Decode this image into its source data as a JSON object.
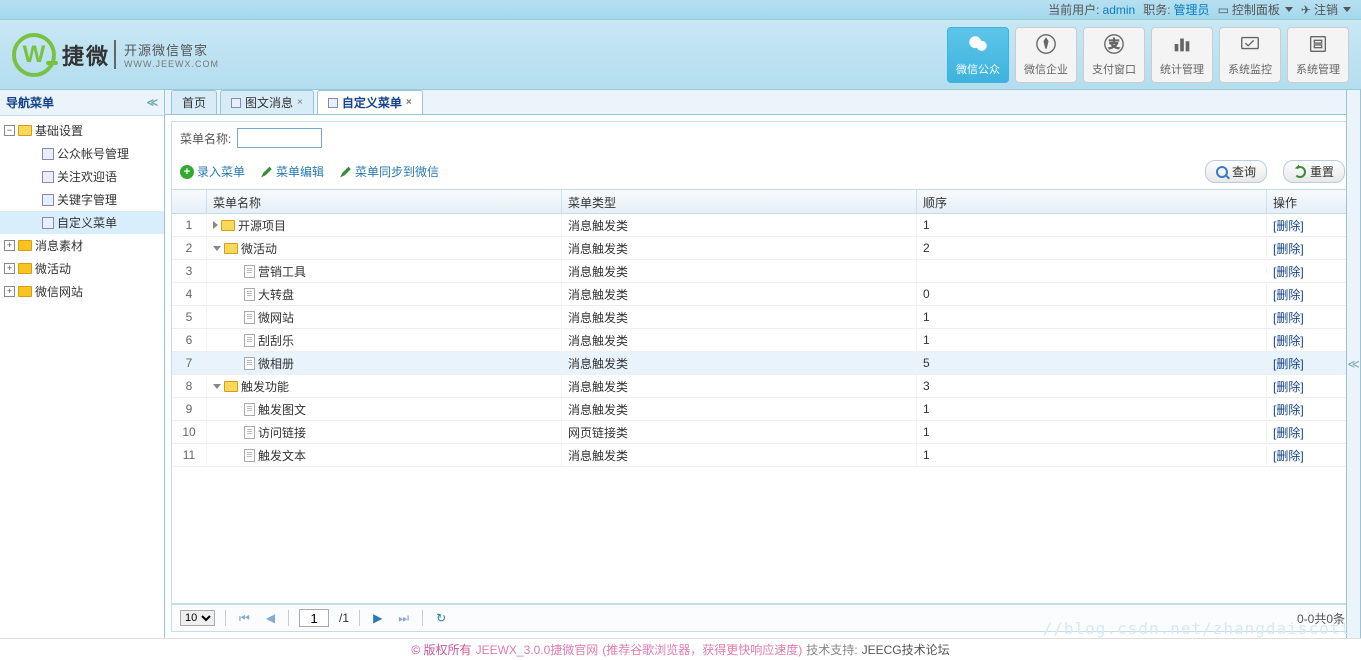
{
  "header": {
    "current_user_label": "当前用户:",
    "current_user": "admin",
    "role_label": "职务:",
    "role": "管理员",
    "control_panel": "控制面板",
    "logout": "注销"
  },
  "logo": {
    "brand_cn": "捷微",
    "sub_cn": "开源微信管家",
    "sub_en": "WWW.JEEWX.COM"
  },
  "modules": [
    {
      "label": "微信公众",
      "icon": "wechat-icon",
      "active": true
    },
    {
      "label": "微信企业",
      "icon": "tie-icon",
      "active": false
    },
    {
      "label": "支付窗口",
      "icon": "pay-icon",
      "active": false
    },
    {
      "label": "统计管理",
      "icon": "stats-icon",
      "active": false
    },
    {
      "label": "系统监控",
      "icon": "monitor-icon",
      "active": false
    },
    {
      "label": "系统管理",
      "icon": "system-icon",
      "active": false
    }
  ],
  "sidebar": {
    "title": "导航菜单",
    "nodes": [
      {
        "label": "基础设置",
        "type": "folder",
        "open": true,
        "level": 0
      },
      {
        "label": "公众帐号管理",
        "type": "item",
        "level": 1
      },
      {
        "label": "关注欢迎语",
        "type": "item",
        "level": 1
      },
      {
        "label": "关键字管理",
        "type": "item",
        "level": 1
      },
      {
        "label": "自定义菜单",
        "type": "item",
        "level": 1,
        "selected": true
      },
      {
        "label": "消息素材",
        "type": "folder",
        "open": false,
        "level": 0
      },
      {
        "label": "微活动",
        "type": "folder",
        "open": false,
        "level": 0
      },
      {
        "label": "微信网站",
        "type": "folder",
        "open": false,
        "level": 0
      }
    ]
  },
  "tabs": [
    {
      "label": "首页",
      "closable": false,
      "active": false
    },
    {
      "label": "图文消息",
      "closable": true,
      "active": false,
      "icon": true
    },
    {
      "label": "自定义菜单",
      "closable": true,
      "active": true,
      "icon": true
    }
  ],
  "toolbar": {
    "name_label": "菜单名称:",
    "name_value": "",
    "add_label": "录入菜单",
    "edit_label": "菜单编辑",
    "sync_label": "菜单同步到微信",
    "search_label": "查询",
    "reset_label": "重置"
  },
  "grid": {
    "columns": {
      "name": "菜单名称",
      "type": "菜单类型",
      "order": "顺序",
      "op": "操作"
    },
    "rows": [
      {
        "idx": 1,
        "toggle": "right",
        "icon": "folder",
        "name": "开源项目",
        "type": "消息触发类",
        "order": "1",
        "op": "[删除]",
        "indent": 0
      },
      {
        "idx": 2,
        "toggle": "down",
        "icon": "folder",
        "name": "微活动",
        "type": "消息触发类",
        "order": "2",
        "op": "[删除]",
        "indent": 0
      },
      {
        "idx": 3,
        "toggle": "",
        "icon": "page",
        "name": "营销工具",
        "type": "消息触发类",
        "order": "",
        "op": "[删除]",
        "indent": 1
      },
      {
        "idx": 4,
        "toggle": "",
        "icon": "page",
        "name": "大转盘",
        "type": "消息触发类",
        "order": "0",
        "op": "[删除]",
        "indent": 1
      },
      {
        "idx": 5,
        "toggle": "",
        "icon": "page",
        "name": "微网站",
        "type": "消息触发类",
        "order": "1",
        "op": "[删除]",
        "indent": 1
      },
      {
        "idx": 6,
        "toggle": "",
        "icon": "page",
        "name": "刮刮乐",
        "type": "消息触发类",
        "order": "1",
        "op": "[删除]",
        "indent": 1
      },
      {
        "idx": 7,
        "toggle": "",
        "icon": "page",
        "name": "微相册",
        "type": "消息触发类",
        "order": "5",
        "op": "[删除]",
        "indent": 1,
        "hover": true
      },
      {
        "idx": 8,
        "toggle": "down",
        "icon": "folder",
        "name": "触发功能",
        "type": "消息触发类",
        "order": "3",
        "op": "[删除]",
        "indent": 0
      },
      {
        "idx": 9,
        "toggle": "",
        "icon": "page",
        "name": "触发图文",
        "type": "消息触发类",
        "order": "1",
        "op": "[删除]",
        "indent": 1
      },
      {
        "idx": 10,
        "toggle": "",
        "icon": "page",
        "name": "访问链接",
        "type": "网页链接类",
        "order": "1",
        "op": "[删除]",
        "indent": 1
      },
      {
        "idx": 11,
        "toggle": "",
        "icon": "page",
        "name": "触发文本",
        "type": "消息触发类",
        "order": "1",
        "op": "[删除]",
        "indent": 1
      }
    ]
  },
  "pager": {
    "page_size": "10",
    "page": "1",
    "total_pages": "/1",
    "info": "0-0共0条"
  },
  "footer": {
    "copyright": "© 版权所有",
    "product": "JEEWX_3.0.0捷微官网",
    "rec": "(推荐谷歌浏览器，获得更快响应速度)",
    "support_label": "技术支持:",
    "support": "JEECG技术论坛"
  },
  "watermark": "//blog.csdn.net/zhangdaiscott"
}
